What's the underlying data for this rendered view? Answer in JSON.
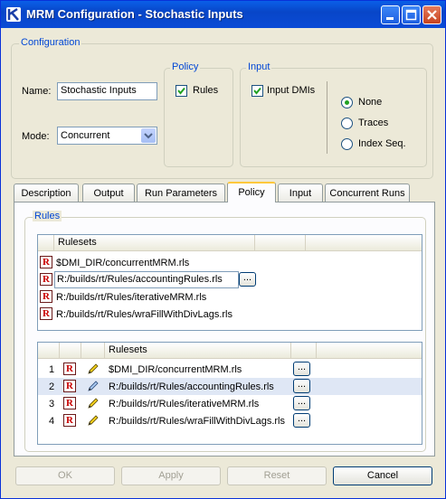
{
  "window": {
    "title": "MRM Configuration - Stochastic Inputs"
  },
  "configuration": {
    "legend": "Configuration",
    "name_label": "Name:",
    "name_value": "Stochastic Inputs",
    "mode_label": "Mode:",
    "mode_value": "Concurrent",
    "policy": {
      "legend": "Policy",
      "rules_label": "Rules",
      "rules_checked": true
    },
    "input": {
      "legend": "Input",
      "dmis_label": "Input DMIs",
      "dmis_checked": true,
      "options": [
        {
          "label": "None",
          "selected": true
        },
        {
          "label": "Traces",
          "selected": false
        },
        {
          "label": "Index Seq.",
          "selected": false
        }
      ]
    }
  },
  "tabs": [
    {
      "label": "Description"
    },
    {
      "label": "Output"
    },
    {
      "label": "Run Parameters"
    },
    {
      "label": "Policy"
    },
    {
      "label": "Input"
    },
    {
      "label": "Concurrent Runs"
    }
  ],
  "active_tab": "Policy",
  "rules": {
    "legend": "Rules",
    "top_table": {
      "header": "Rulesets",
      "rows": [
        {
          "icon": "R",
          "path": "$DMI_DIR/concurrentMRM.rls"
        },
        {
          "icon": "R",
          "path": "R:/builds/rt/Rules/accountingRules.rls",
          "editing": true,
          "button": "..."
        },
        {
          "icon": "R",
          "path": "R:/builds/rt/Rules/iterativeMRM.rls"
        },
        {
          "icon": "R",
          "path": "R:/builds/rt/Rules/wraFillWithDivLags.rls"
        }
      ]
    },
    "bottom_table": {
      "header": "Rulesets",
      "rows": [
        {
          "num": "1",
          "icon": "R",
          "path": "$DMI_DIR/concurrentMRM.rls",
          "button": "..."
        },
        {
          "num": "2",
          "icon": "R",
          "path": "R:/builds/rt/Rules/accountingRules.rls",
          "button": "...",
          "selected": true
        },
        {
          "num": "3",
          "icon": "R",
          "path": "R:/builds/rt/Rules/iterativeMRM.rls",
          "button": "..."
        },
        {
          "num": "4",
          "icon": "R",
          "path": "R:/builds/rt/Rules/wraFillWithDivLags.rls",
          "button": "..."
        }
      ]
    }
  },
  "buttons": {
    "ok": "OK",
    "apply": "Apply",
    "reset": "Reset",
    "cancel": "Cancel"
  },
  "colors": {
    "accent": "#0046d5",
    "titlebar": "#0a4bd6",
    "selected_row": "#dfe7f5",
    "tab_highlight": "#ffc83c"
  }
}
